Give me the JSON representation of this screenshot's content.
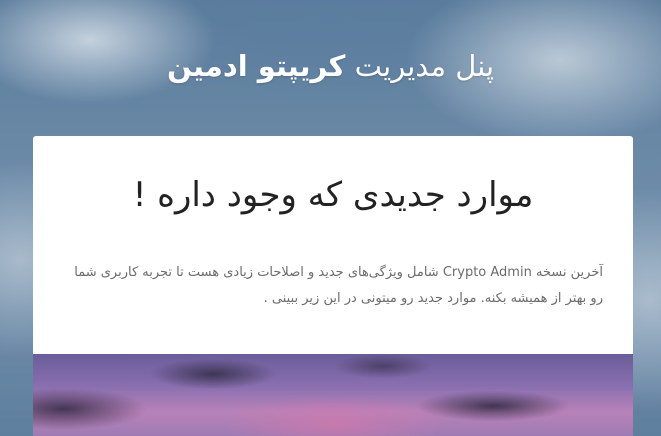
{
  "header": {
    "title_regular": "پنل مدیریت",
    "title_bold": "کریپتو ادمین"
  },
  "card": {
    "heading": "موارد جدیدی که وجود داره !",
    "description": "آخرین نسخه Crypto Admin شامل ویژگی‌های جدید و اصلاحات زیادی هست تا تجربه کاربری شما رو بهتر از همیشه بکنه. موارد جدید رو میتونی در این زیر ببینی ."
  }
}
